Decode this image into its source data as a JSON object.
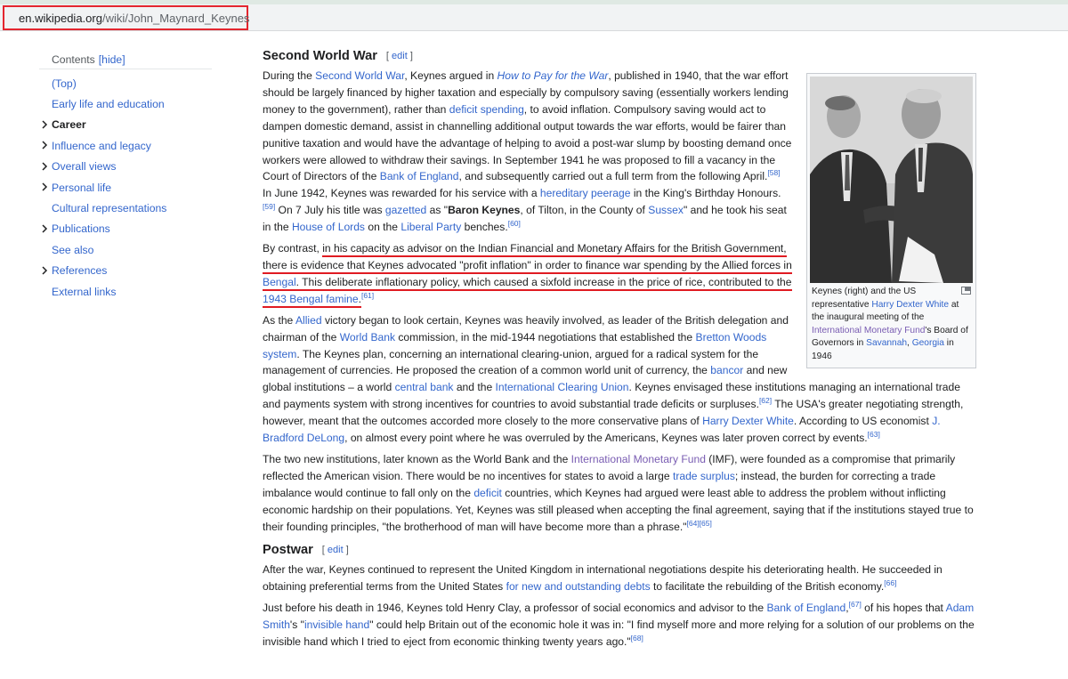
{
  "browser": {
    "url_domain": "en.wikipedia.org",
    "url_path": "/wiki/John_Maynard_Keynes"
  },
  "toc": {
    "title": "Contents",
    "hide_label": "[hide]",
    "items": [
      {
        "label": "(Top)",
        "expandable": false,
        "current": false
      },
      {
        "label": "Early life and education",
        "expandable": false,
        "current": false
      },
      {
        "label": "Career",
        "expandable": true,
        "current": true
      },
      {
        "label": "Influence and legacy",
        "expandable": true,
        "current": false
      },
      {
        "label": "Overall views",
        "expandable": true,
        "current": false
      },
      {
        "label": "Personal life",
        "expandable": true,
        "current": false
      },
      {
        "label": "Cultural representations",
        "expandable": false,
        "current": false
      },
      {
        "label": "Publications",
        "expandable": true,
        "current": false
      },
      {
        "label": "See also",
        "expandable": false,
        "current": false
      },
      {
        "label": "References",
        "expandable": true,
        "current": false
      },
      {
        "label": "External links",
        "expandable": false,
        "current": false
      }
    ]
  },
  "section1": {
    "heading": "Second World War",
    "edit_label": "edit",
    "p1": {
      "t1": "During the ",
      "l1": "Second World War",
      "t2": ", Keynes argued in ",
      "l2": "How to Pay for the War",
      "t3": ", published in 1940, that the war effort should be largely financed by higher taxation and especially by compulsory saving (essentially workers lending money to the government), rather than ",
      "l3": "deficit spending",
      "t4": ", to avoid inflation. Compulsory saving would act to dampen domestic demand, assist in channelling additional output towards the war efforts, would be fairer than punitive taxation and would have the advantage of helping to avoid a post-war slump by boosting demand once workers were allowed to withdraw their savings. In September 1941 he was proposed to fill a vacancy in the Court of Directors of the ",
      "l4": "Bank of England",
      "t5": ", and subsequently carried out a full term from the following April.",
      "s1": "[58]",
      "t6": " In June 1942, Keynes was rewarded for his service with a ",
      "l5": "hereditary peerage",
      "t7": " in the King's Birthday Honours.",
      "s2": "[59]",
      "t8": " On 7 July his title was ",
      "l6": "gazetted",
      "t9": " as \"",
      "b1": "Baron Keynes",
      "t10": ", of Tilton, in the County of ",
      "l7": "Sussex",
      "t11": "\" and he took his seat in the ",
      "l8": "House of Lords",
      "t12": " on the ",
      "l9": "Liberal Party",
      "t13": " benches.",
      "s3": "[60]"
    },
    "p2": {
      "t1": "By contrast, ",
      "u1": "in his capacity as advisor on the Indian Financial and Monetary Affairs for the British Government, there is evidence that Keynes advocated \"profit inflation\" in order to finance war spending by the Allied forces in ",
      "ul1": "Bengal",
      "u2": ". This deliberate inflationary policy, which caused a sixfold increase in the price of rice, contributed to the ",
      "ul2": "1943 Bengal famine",
      "u3": ".",
      "s1": "[61]"
    },
    "p3": {
      "t1": "As the ",
      "l1": "Allied",
      "t2": " victory began to look certain, Keynes was heavily involved, as leader of the British delegation and chairman of the ",
      "l2": "World Bank",
      "t3": " commission, in the mid-1944 negotiations that established the ",
      "l3": "Bretton Woods system",
      "t4": ". The Keynes plan, concerning an international clearing-union, argued for a radical system for the management of currencies. He proposed the creation of a common world unit of currency, the ",
      "l4": "bancor",
      "t5": " and new global institutions – a world ",
      "l5": "central bank",
      "t6": " and the ",
      "l6": "International Clearing Union",
      "t7": ". Keynes envisaged these institutions managing an international trade and payments system with strong incentives for countries to avoid substantial trade deficits or surpluses.",
      "s1": "[62]",
      "t8": " The USA's greater negotiating strength, however, meant that the outcomes accorded more closely to the more conservative plans of ",
      "l7": "Harry Dexter White",
      "t9": ". According to US economist ",
      "l8": "J. Bradford DeLong",
      "t10": ", on almost every point where he was overruled by the Americans, Keynes was later proven correct by events.",
      "s2": "[63]"
    },
    "p4": {
      "t1": "The two new institutions, later known as the World Bank and the ",
      "l1": "International Monetary Fund",
      "t2": " (IMF), were founded as a compromise that primarily reflected the American vision. There would be no incentives for states to avoid a large ",
      "l2": "trade surplus",
      "t3": "; instead, the burden for correcting a trade imbalance would continue to fall only on the ",
      "l3": "deficit",
      "t4": " countries, which Keynes had argued were least able to address the problem without inflicting economic hardship on their populations. Yet, Keynes was still pleased when accepting the final agreement, saying that if the institutions stayed true to their founding principles, \"the brotherhood of man will have become more than a phrase.\"",
      "s1": "[64]",
      "s2": "[65]"
    }
  },
  "figure": {
    "cap_t1": "Keynes (right) and the US representative ",
    "cap_l1": "Harry Dexter White",
    "cap_t2": " at the inaugural meeting of the ",
    "cap_l2": "International Monetary Fund",
    "cap_t3": "'s Board of Governors in ",
    "cap_l3": "Savannah",
    "cap_t4": ", ",
    "cap_l4": "Georgia",
    "cap_t5": " in 1946"
  },
  "section2": {
    "heading": "Postwar",
    "edit_label": "edit",
    "p1": {
      "t1": "After the war, Keynes continued to represent the United Kingdom in international negotiations despite his deteriorating health. He succeeded in obtaining preferential terms from the United States ",
      "l1": "for new and outstanding debts",
      "t2": " to facilitate the rebuilding of the British economy.",
      "s1": "[66]"
    },
    "p2": {
      "t1": "Just before his death in 1946, Keynes told Henry Clay, a professor of social economics and advisor to the ",
      "l1": "Bank of England",
      "t2": ",",
      "s1": "[67]",
      "t3": " of his hopes that ",
      "l2": "Adam Smith",
      "t4": "'s \"",
      "l3": "invisible hand",
      "t5": "\" could help Britain out of the economic hole it was in: \"I find myself more and more relying for a solution of our problems on the invisible hand which I tried to eject from economic thinking twenty years ago.\"",
      "s2": "[68]"
    }
  }
}
